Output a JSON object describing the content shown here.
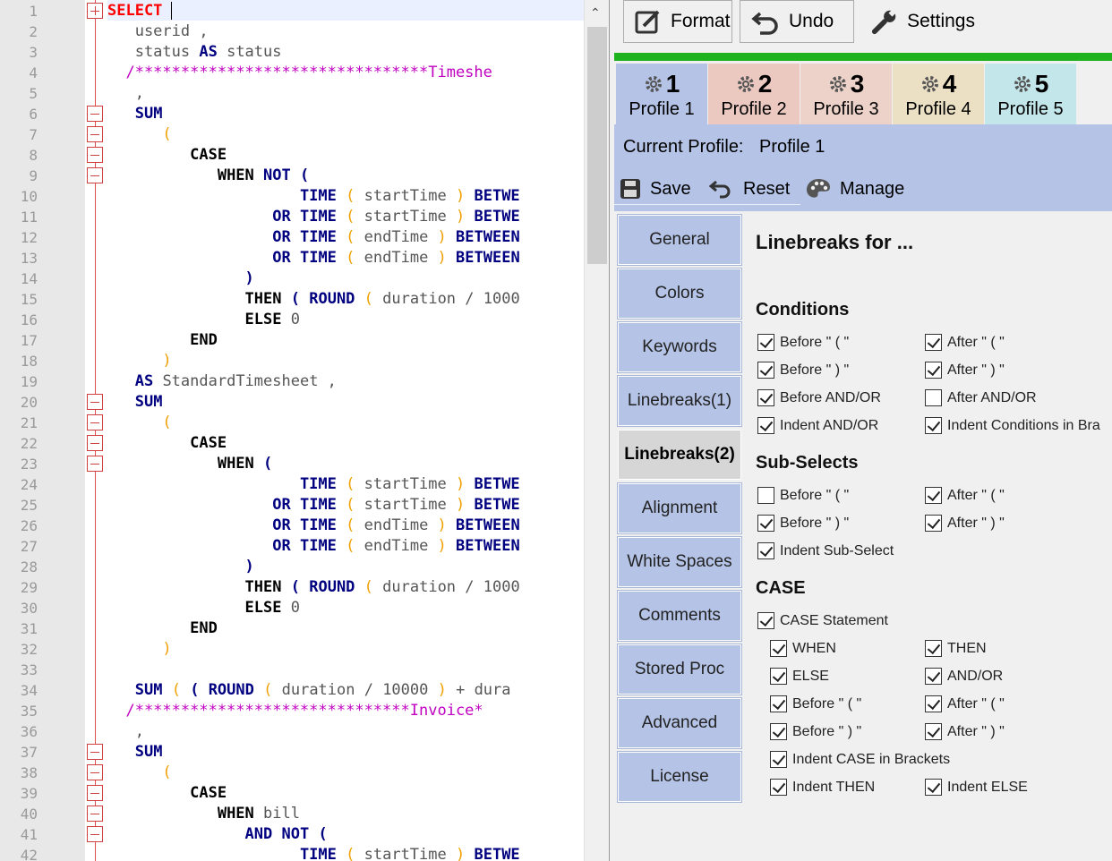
{
  "editor": {
    "line_numbers": [
      "1",
      "2",
      "3",
      "4",
      "5",
      "6",
      "7",
      "8",
      "9",
      "10",
      "11",
      "12",
      "13",
      "14",
      "15",
      "16",
      "17",
      "18",
      "19",
      "20",
      "21",
      "22",
      "23",
      "24",
      "25",
      "26",
      "27",
      "28",
      "29",
      "30",
      "31",
      "32",
      "33",
      "34",
      "35",
      "36",
      "37",
      "38",
      "39",
      "40",
      "41",
      "42"
    ],
    "lines": [
      [
        {
          "t": "SELECT",
          "c": "r"
        }
      ],
      [
        {
          "t": "   userid ,",
          "c": ""
        }
      ],
      [
        {
          "t": "   status ",
          "c": ""
        },
        {
          "t": "AS",
          "c": "k"
        },
        {
          "t": " status",
          "c": ""
        }
      ],
      [
        {
          "t": "  /********************************",
          "c": "s"
        },
        {
          "t": "Timeshe",
          "c": "s"
        }
      ],
      [
        {
          "t": "   ,",
          "c": ""
        }
      ],
      [
        {
          "t": "   ",
          "c": ""
        },
        {
          "t": "SUM",
          "c": "k"
        }
      ],
      [
        {
          "t": "      ",
          "c": ""
        },
        {
          "t": "(",
          "c": "p"
        }
      ],
      [
        {
          "t": "         ",
          "c": ""
        },
        {
          "t": "CASE",
          "c": "kb"
        }
      ],
      [
        {
          "t": "            ",
          "c": ""
        },
        {
          "t": "WHEN",
          "c": "kb"
        },
        {
          "t": " ",
          "c": ""
        },
        {
          "t": "NOT",
          "c": "k"
        },
        {
          "t": " ",
          "c": ""
        },
        {
          "t": "(",
          "c": "k"
        }
      ],
      [
        {
          "t": "                     ",
          "c": ""
        },
        {
          "t": "TIME",
          "c": "k"
        },
        {
          "t": " ",
          "c": ""
        },
        {
          "t": "(",
          "c": "p"
        },
        {
          "t": " startTime ",
          "c": ""
        },
        {
          "t": ")",
          "c": "p"
        },
        {
          "t": " ",
          "c": ""
        },
        {
          "t": "BETWE",
          "c": "k"
        }
      ],
      [
        {
          "t": "                  ",
          "c": ""
        },
        {
          "t": "OR",
          "c": "k"
        },
        {
          "t": " ",
          "c": ""
        },
        {
          "t": "TIME",
          "c": "k"
        },
        {
          "t": " ",
          "c": ""
        },
        {
          "t": "(",
          "c": "p"
        },
        {
          "t": " startTime ",
          "c": ""
        },
        {
          "t": ")",
          "c": "p"
        },
        {
          "t": " ",
          "c": ""
        },
        {
          "t": "BETWE",
          "c": "k"
        }
      ],
      [
        {
          "t": "                  ",
          "c": ""
        },
        {
          "t": "OR",
          "c": "k"
        },
        {
          "t": " ",
          "c": ""
        },
        {
          "t": "TIME",
          "c": "k"
        },
        {
          "t": " ",
          "c": ""
        },
        {
          "t": "(",
          "c": "p"
        },
        {
          "t": " endTime ",
          "c": ""
        },
        {
          "t": ")",
          "c": "p"
        },
        {
          "t": " ",
          "c": ""
        },
        {
          "t": "BETWEEN",
          "c": "k"
        }
      ],
      [
        {
          "t": "                  ",
          "c": ""
        },
        {
          "t": "OR",
          "c": "k"
        },
        {
          "t": " ",
          "c": ""
        },
        {
          "t": "TIME",
          "c": "k"
        },
        {
          "t": " ",
          "c": ""
        },
        {
          "t": "(",
          "c": "p"
        },
        {
          "t": " endTime ",
          "c": ""
        },
        {
          "t": ")",
          "c": "p"
        },
        {
          "t": " ",
          "c": ""
        },
        {
          "t": "BETWEEN",
          "c": "k"
        }
      ],
      [
        {
          "t": "               ",
          "c": ""
        },
        {
          "t": ")",
          "c": "k"
        }
      ],
      [
        {
          "t": "               ",
          "c": ""
        },
        {
          "t": "THEN",
          "c": "kb"
        },
        {
          "t": " ",
          "c": ""
        },
        {
          "t": "(",
          "c": "k"
        },
        {
          "t": " ",
          "c": ""
        },
        {
          "t": "ROUND",
          "c": "k"
        },
        {
          "t": " ",
          "c": ""
        },
        {
          "t": "(",
          "c": "p"
        },
        {
          "t": " duration / 1000",
          "c": ""
        }
      ],
      [
        {
          "t": "               ",
          "c": ""
        },
        {
          "t": "ELSE",
          "c": "kb"
        },
        {
          "t": " 0",
          "c": ""
        }
      ],
      [
        {
          "t": "         ",
          "c": ""
        },
        {
          "t": "END",
          "c": "kb"
        }
      ],
      [
        {
          "t": "      ",
          "c": ""
        },
        {
          "t": ")",
          "c": "p"
        }
      ],
      [
        {
          "t": "   ",
          "c": ""
        },
        {
          "t": "AS",
          "c": "k"
        },
        {
          "t": " StandardTimesheet ,",
          "c": ""
        }
      ],
      [
        {
          "t": "   ",
          "c": ""
        },
        {
          "t": "SUM",
          "c": "k"
        }
      ],
      [
        {
          "t": "      ",
          "c": ""
        },
        {
          "t": "(",
          "c": "p"
        }
      ],
      [
        {
          "t": "         ",
          "c": ""
        },
        {
          "t": "CASE",
          "c": "kb"
        }
      ],
      [
        {
          "t": "            ",
          "c": ""
        },
        {
          "t": "WHEN",
          "c": "kb"
        },
        {
          "t": " ",
          "c": ""
        },
        {
          "t": "(",
          "c": "k"
        }
      ],
      [
        {
          "t": "                     ",
          "c": ""
        },
        {
          "t": "TIME",
          "c": "k"
        },
        {
          "t": " ",
          "c": ""
        },
        {
          "t": "(",
          "c": "p"
        },
        {
          "t": " startTime ",
          "c": ""
        },
        {
          "t": ")",
          "c": "p"
        },
        {
          "t": " ",
          "c": ""
        },
        {
          "t": "BETWE",
          "c": "k"
        }
      ],
      [
        {
          "t": "                  ",
          "c": ""
        },
        {
          "t": "OR",
          "c": "k"
        },
        {
          "t": " ",
          "c": ""
        },
        {
          "t": "TIME",
          "c": "k"
        },
        {
          "t": " ",
          "c": ""
        },
        {
          "t": "(",
          "c": "p"
        },
        {
          "t": " startTime ",
          "c": ""
        },
        {
          "t": ")",
          "c": "p"
        },
        {
          "t": " ",
          "c": ""
        },
        {
          "t": "BETWE",
          "c": "k"
        }
      ],
      [
        {
          "t": "                  ",
          "c": ""
        },
        {
          "t": "OR",
          "c": "k"
        },
        {
          "t": " ",
          "c": ""
        },
        {
          "t": "TIME",
          "c": "k"
        },
        {
          "t": " ",
          "c": ""
        },
        {
          "t": "(",
          "c": "p"
        },
        {
          "t": " endTime ",
          "c": ""
        },
        {
          "t": ")",
          "c": "p"
        },
        {
          "t": " ",
          "c": ""
        },
        {
          "t": "BETWEEN",
          "c": "k"
        }
      ],
      [
        {
          "t": "                  ",
          "c": ""
        },
        {
          "t": "OR",
          "c": "k"
        },
        {
          "t": " ",
          "c": ""
        },
        {
          "t": "TIME",
          "c": "k"
        },
        {
          "t": " ",
          "c": ""
        },
        {
          "t": "(",
          "c": "p"
        },
        {
          "t": " endTime ",
          "c": ""
        },
        {
          "t": ")",
          "c": "p"
        },
        {
          "t": " ",
          "c": ""
        },
        {
          "t": "BETWEEN",
          "c": "k"
        }
      ],
      [
        {
          "t": "               ",
          "c": ""
        },
        {
          "t": ")",
          "c": "k"
        }
      ],
      [
        {
          "t": "               ",
          "c": ""
        },
        {
          "t": "THEN",
          "c": "kb"
        },
        {
          "t": " ",
          "c": ""
        },
        {
          "t": "(",
          "c": "k"
        },
        {
          "t": " ",
          "c": ""
        },
        {
          "t": "ROUND",
          "c": "k"
        },
        {
          "t": " ",
          "c": ""
        },
        {
          "t": "(",
          "c": "p"
        },
        {
          "t": " duration / 1000",
          "c": ""
        }
      ],
      [
        {
          "t": "               ",
          "c": ""
        },
        {
          "t": "ELSE",
          "c": "kb"
        },
        {
          "t": " 0",
          "c": ""
        }
      ],
      [
        {
          "t": "         ",
          "c": ""
        },
        {
          "t": "END",
          "c": "kb"
        }
      ],
      [
        {
          "t": "      ",
          "c": ""
        },
        {
          "t": ")",
          "c": "p"
        }
      ],
      [
        {
          "t": "",
          "c": ""
        }
      ],
      [
        {
          "t": "   ",
          "c": ""
        },
        {
          "t": "SUM",
          "c": "k"
        },
        {
          "t": " ",
          "c": ""
        },
        {
          "t": "(",
          "c": "p"
        },
        {
          "t": " ",
          "c": ""
        },
        {
          "t": "(",
          "c": "k"
        },
        {
          "t": " ",
          "c": ""
        },
        {
          "t": "ROUND",
          "c": "k"
        },
        {
          "t": " ",
          "c": ""
        },
        {
          "t": "(",
          "c": "p"
        },
        {
          "t": " duration / 10000 ",
          "c": ""
        },
        {
          "t": ")",
          "c": "p"
        },
        {
          "t": " + dura",
          "c": ""
        }
      ],
      [
        {
          "t": "  /******************************",
          "c": "s"
        },
        {
          "t": "Invoice*",
          "c": "s"
        }
      ],
      [
        {
          "t": "   ,",
          "c": ""
        }
      ],
      [
        {
          "t": "   ",
          "c": ""
        },
        {
          "t": "SUM",
          "c": "k"
        }
      ],
      [
        {
          "t": "      ",
          "c": ""
        },
        {
          "t": "(",
          "c": "p"
        }
      ],
      [
        {
          "t": "         ",
          "c": ""
        },
        {
          "t": "CASE",
          "c": "kb"
        }
      ],
      [
        {
          "t": "            ",
          "c": ""
        },
        {
          "t": "WHEN",
          "c": "kb"
        },
        {
          "t": " bill",
          "c": ""
        }
      ],
      [
        {
          "t": "               ",
          "c": ""
        },
        {
          "t": "AND",
          "c": "k"
        },
        {
          "t": " ",
          "c": ""
        },
        {
          "t": "NOT",
          "c": "k"
        },
        {
          "t": " ",
          "c": ""
        },
        {
          "t": "(",
          "c": "k"
        }
      ],
      [
        {
          "t": "                     ",
          "c": ""
        },
        {
          "t": "TIME",
          "c": "k"
        },
        {
          "t": " ",
          "c": ""
        },
        {
          "t": "(",
          "c": "p"
        },
        {
          "t": " startTime ",
          "c": ""
        },
        {
          "t": ")",
          "c": "p"
        },
        {
          "t": " ",
          "c": ""
        },
        {
          "t": "BETWE",
          "c": "k"
        }
      ]
    ]
  },
  "toolbar": {
    "format_label": "Format",
    "undo_label": "Undo",
    "settings_label": "Settings"
  },
  "profiles": [
    {
      "num": "1",
      "label": "Profile 1",
      "color": "#b4c3e6"
    },
    {
      "num": "2",
      "label": "Profile 2",
      "color": "#ebc8c0"
    },
    {
      "num": "3",
      "label": "Profile 3",
      "color": "#ecd2c8"
    },
    {
      "num": "4",
      "label": "Profile 4",
      "color": "#ece0c4"
    },
    {
      "num": "5",
      "label": "Profile 5",
      "color": "#c2e6ea"
    }
  ],
  "current_profile": {
    "label": "Current Profile:",
    "value": "Profile 1"
  },
  "profile_actions": {
    "save": "Save",
    "reset": "Reset",
    "manage": "Manage"
  },
  "sidebar": [
    {
      "label": "General",
      "active": false
    },
    {
      "label": "Colors",
      "active": false
    },
    {
      "label": "Keywords",
      "active": false
    },
    {
      "label": "Linebreaks(1)",
      "active": false
    },
    {
      "label": "Linebreaks(2)",
      "active": true
    },
    {
      "label": "Alignment",
      "active": false
    },
    {
      "label": "White Spaces",
      "active": false
    },
    {
      "label": "Comments",
      "active": false
    },
    {
      "label": "Stored Proc",
      "active": false
    },
    {
      "label": "Advanced",
      "active": false
    },
    {
      "label": "License",
      "active": false
    }
  ],
  "content": {
    "title": "Linebreaks for ...",
    "sections": {
      "conditions": {
        "title": "Conditions"
      },
      "subselects": {
        "title": "Sub-Selects"
      },
      "case": {
        "title": "CASE"
      }
    },
    "checkboxes": [
      {
        "label": "Before \" ( \"",
        "checked": true
      },
      {
        "label": "After \" ( \"",
        "checked": true
      },
      {
        "label": "Before \" ) \"",
        "checked": true
      },
      {
        "label": "After \" ) \"",
        "checked": true
      },
      {
        "label": "Before AND/OR",
        "checked": true
      },
      {
        "label": "After AND/OR",
        "checked": false
      },
      {
        "label": "Indent AND/OR",
        "checked": true
      },
      {
        "label": "Indent Conditions in Bra",
        "checked": true
      },
      {
        "label": "Before \" ( \"",
        "checked": false
      },
      {
        "label": "After \" ( \"",
        "checked": true
      },
      {
        "label": "Before \" ) \"",
        "checked": true
      },
      {
        "label": "After \" ) \"",
        "checked": true
      },
      {
        "label": "Indent Sub-Select",
        "checked": true
      },
      {
        "label": "CASE Statement",
        "checked": true
      },
      {
        "label": "WHEN",
        "checked": true
      },
      {
        "label": "THEN",
        "checked": true
      },
      {
        "label": "ELSE",
        "checked": true
      },
      {
        "label": "AND/OR",
        "checked": true
      },
      {
        "label": "Before \" ( \"",
        "checked": true
      },
      {
        "label": "After \" ( \"",
        "checked": true
      },
      {
        "label": "Before \" ) \"",
        "checked": true
      },
      {
        "label": "After \" ) \"",
        "checked": true
      },
      {
        "label": "Indent CASE in Brackets",
        "checked": true
      },
      {
        "label": "Indent THEN",
        "checked": true
      },
      {
        "label": "Indent ELSE",
        "checked": true
      }
    ]
  }
}
